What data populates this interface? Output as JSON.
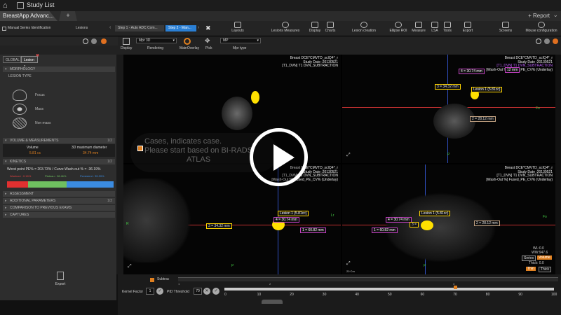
{
  "titlebar": {
    "title": "Study List"
  },
  "tabs": {
    "app_tab": "BreastApp Advanc...",
    "new_tab": "+",
    "report": "+ Report"
  },
  "toolbar": {
    "workflow": {
      "series_label": "Manual Series Identification",
      "lesions_label": "Lesions",
      "step1": "Step 1 - Auto ADC Com...",
      "step2": "Step 2 - Man..."
    },
    "tools": [
      "Layouts",
      "Lesions Measures",
      "Display",
      "Charts",
      "Lesion creation",
      "Ellipse ROI",
      "Measure",
      "LSA",
      "Tools",
      "Export",
      "Screens",
      "Mouse configuration"
    ]
  },
  "viewer_toolbar": {
    "display_label": "Display",
    "rendering_label": "Rendering",
    "rendering_value": "Mpr 3D",
    "main_overlay_label": "MainOverlay",
    "pick_label": "Pick",
    "mpr_type_label": "Mpr type",
    "mpr_type_value": "MP"
  },
  "left_panel": {
    "tabs": [
      "GLOBAL",
      "Lesion 1"
    ],
    "morphology": "MORPHOLOGY",
    "lesion_type": "LESION TYPE",
    "lesion_options": [
      "Focus",
      "Mass",
      "Non mass"
    ],
    "volume_section": "VOLUME & MEASUREMENTS",
    "volume_num": "1/2",
    "volume_col1": "Volume",
    "volume_col2": "3D maximum diameter",
    "volume_val1": "5.81 cc",
    "volume_val2": "34.74 mm",
    "kinetics_section": "KINETICS",
    "kinetics_num": "1/2",
    "kinetics_line": "Worst point PE% = 203.73% / Curve Wash-out % = -36.19%",
    "kinetics_legend": [
      "Washout : 0.16%",
      "Plateau : 28.46%",
      "Persistent : 35.39%"
    ],
    "kinetics_fractions": [
      0.16,
      0.2846,
      0.3539
    ],
    "sections": [
      "ASSESSMENT",
      "ADDITIONAL PARAMETERS",
      "COMPARISON TO PREVIOUS EXAMS",
      "CAPTURES"
    ],
    "additional_num": "1/2",
    "export": "Export"
  },
  "overlay_caption": [
    "Cases, indicates case.",
    "Please start based on BI-RADS",
    "ATLAS"
  ],
  "viewports": {
    "tl": {
      "line1": "Breast DCE*CMVTD_scIQ4*_r",
      "line2": "Study Date :20130521",
      "line3": "[T1_DVN] T1 DVN_SUBTRACTION"
    },
    "tr": {
      "line1": "Breast DCE*CMVTD_scIQ4*_r",
      "line2": "Study Date :20130521",
      "line3": "[T1_DVN] T1 DVN_SUBTRACTION",
      "line4": "[Wash-Out %] Fused_PE_CV% (Underlay)",
      "m4": "4 = 30.74 mm",
      "m3": "3 = 34.32 mm",
      "m2": "2 = 28.12 mm",
      "lesion": "Lesion 1 (5.81cc)",
      "m1": "12 mm"
    },
    "bl": {
      "line1": "Breast DCE*CMVTD_scIQ4*_r",
      "line2": "Study Date :20130521",
      "line3": "[T1_DVN] T1 DVN_SUBTRACTION",
      "line4": "[Wash-Out %] Fused_PE_CV% (Underlay)",
      "lesion": "Lesion 1 (5.81cc)",
      "m3": "3 = 34.32 mm",
      "m4": "4 = 30.74 mm",
      "m1": "1 = 60.82 mm"
    },
    "br": {
      "line1": "Breast DCE*CMVTD_scIQ4*_r",
      "line2": "Study Date :20130521",
      "line3": "[T1_DVN] T1 DVN_SUBTRACTION",
      "line4": "[Wash-Out %] Fused_PE_CV% (Underlay)",
      "lesion": "Lesion 1 (5.81cc)",
      "m4": "4 = 30.74 mm",
      "m1": "1 = 60.82 mm",
      "m3": "3 =",
      "m2": "2 = 28.12 mm",
      "wl": "WL:0.0",
      "ww": "WW:947.6",
      "series": "Series",
      "volume": "Volume",
      "thick_label": "Thick: 0.0",
      "thin": "Thin",
      "thick": "Thick",
      "scale": "20 Cm"
    },
    "orient": {
      "r": "R",
      "l": "Lr",
      "p": "P",
      "f": "Fo"
    }
  },
  "bottom": {
    "subtrac": "Subtrac",
    "kernel_label": "Kernel Factor",
    "kernel_value": "1",
    "pid_label": "PID Threshold",
    "pid_value": "70",
    "ticks": [
      "0",
      "10",
      "20",
      "30",
      "40",
      "50",
      "60",
      "70",
      "80",
      "90",
      "100"
    ],
    "top_ticks": [
      "1",
      "2",
      "3"
    ]
  }
}
